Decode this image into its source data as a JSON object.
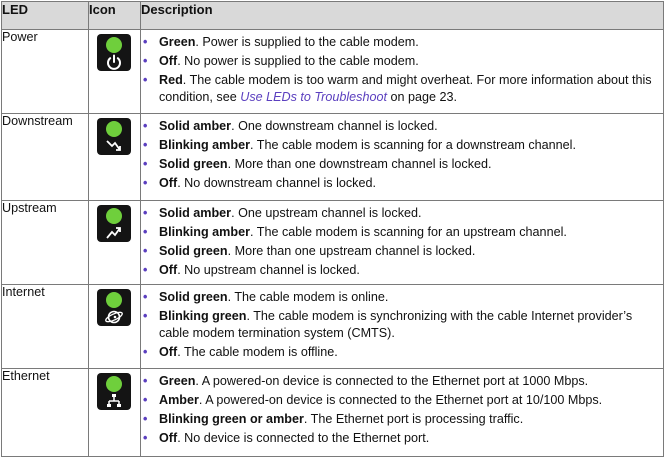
{
  "header": {
    "led": "LED",
    "icon": "Icon",
    "description": "Description"
  },
  "rows": [
    {
      "led": "Power",
      "icon": "power-icon",
      "items": [
        {
          "strong": "Green",
          "text": ". Power is supplied to the cable modem."
        },
        {
          "strong": "Off",
          "text": ". No power is supplied to the cable modem."
        },
        {
          "strong": "Red",
          "text": ". The cable modem is too warm and might overheat. For more information about this condition, see ",
          "link": "Use LEDs to Troubleshoot",
          "tail": " on page 23."
        }
      ]
    },
    {
      "led": "Downstream",
      "icon": "downstream-arrow-icon",
      "items": [
        {
          "strong": "Solid amber",
          "text": ". One downstream channel is locked."
        },
        {
          "strong": "Blinking amber",
          "text": ". The cable modem is scanning for a downstream channel."
        },
        {
          "strong": "Solid green",
          "text": ". More than one downstream channel is locked."
        },
        {
          "strong": "Off",
          "text": ". No downstream channel is locked."
        }
      ]
    },
    {
      "led": "Upstream",
      "icon": "upstream-arrow-icon",
      "items": [
        {
          "strong": "Solid amber",
          "text": ". One upstream channel is locked."
        },
        {
          "strong": "Blinking amber",
          "text": ". The cable modem is scanning for an upstream channel."
        },
        {
          "strong": "Solid green",
          "text": ". More than one upstream channel is locked."
        },
        {
          "strong": "Off",
          "text": ". No upstream channel is locked."
        }
      ]
    },
    {
      "led": "Internet",
      "icon": "globe-icon",
      "items": [
        {
          "strong": "Solid green",
          "text": ". The cable modem is online."
        },
        {
          "strong": "Blinking green",
          "text": ". The cable modem is synchronizing with the cable Internet provider’s cable modem termination system (CMTS)."
        },
        {
          "strong": "Off",
          "text": ". The cable modem is offline."
        }
      ]
    },
    {
      "led": "Ethernet",
      "icon": "ethernet-icon",
      "items": [
        {
          "strong": "Green",
          "text": ". A powered-on device is connected to the Ethernet port at 1000 Mbps."
        },
        {
          "strong": "Amber",
          "text": ". A powered-on device is connected to the Ethernet port at 10/100 Mbps."
        },
        {
          "strong": "Blinking green or amber",
          "text": ". The Ethernet port is processing traffic."
        },
        {
          "strong": "Off",
          "text": ". No device is connected to the Ethernet port."
        }
      ]
    }
  ],
  "colors": {
    "led_green": "#6fcf3c",
    "icon_bg": "#141414",
    "header_bg": "#d9d9d9",
    "bullet": "#5b3fbf",
    "link": "#5b3fbf"
  }
}
